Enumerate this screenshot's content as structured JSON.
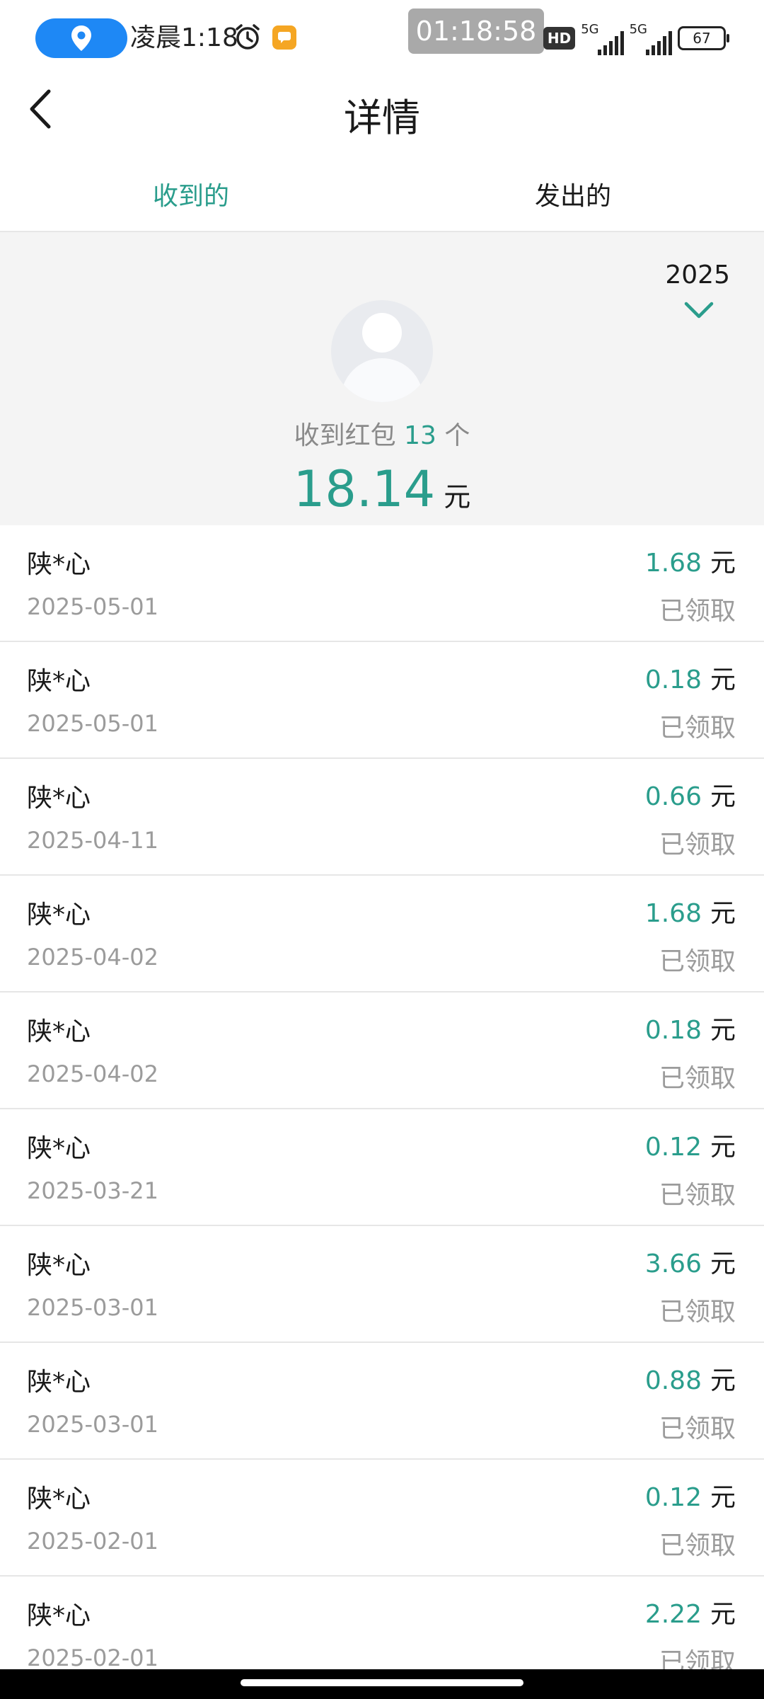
{
  "status_bar": {
    "time": "凌晨1:18",
    "clock_overlay": "01:18:58",
    "hd_badge": "HD",
    "network_1": "5G",
    "network_2": "5G",
    "battery": "67"
  },
  "header": {
    "title": "详情"
  },
  "tabs": [
    {
      "label": "收到的",
      "active": true
    },
    {
      "label": "发出的",
      "active": false
    }
  ],
  "summary": {
    "year": "2025",
    "count_prefix": "收到红包",
    "count": "13",
    "count_suffix": "个",
    "total": "18.14",
    "total_unit": "元"
  },
  "records": [
    {
      "name": "陕*心",
      "date": "2025-05-01",
      "amount": "1.68",
      "unit": "元",
      "status": "已领取"
    },
    {
      "name": "陕*心",
      "date": "2025-05-01",
      "amount": "0.18",
      "unit": "元",
      "status": "已领取"
    },
    {
      "name": "陕*心",
      "date": "2025-04-11",
      "amount": "0.66",
      "unit": "元",
      "status": "已领取"
    },
    {
      "name": "陕*心",
      "date": "2025-04-02",
      "amount": "1.68",
      "unit": "元",
      "status": "已领取"
    },
    {
      "name": "陕*心",
      "date": "2025-04-02",
      "amount": "0.18",
      "unit": "元",
      "status": "已领取"
    },
    {
      "name": "陕*心",
      "date": "2025-03-21",
      "amount": "0.12",
      "unit": "元",
      "status": "已领取"
    },
    {
      "name": "陕*心",
      "date": "2025-03-01",
      "amount": "3.66",
      "unit": "元",
      "status": "已领取"
    },
    {
      "name": "陕*心",
      "date": "2025-03-01",
      "amount": "0.88",
      "unit": "元",
      "status": "已领取"
    },
    {
      "name": "陕*心",
      "date": "2025-02-01",
      "amount": "0.12",
      "unit": "元",
      "status": "已领取"
    },
    {
      "name": "陕*心",
      "date": "2025-02-01",
      "amount": "2.22",
      "unit": "元",
      "status": "已领取"
    }
  ],
  "colors": {
    "accent": "#2a9d8c",
    "location_pill": "#1e88f5",
    "summary_bg": "#f4f4f4"
  },
  "icons": {
    "location": "location-pin-icon",
    "alarm": "alarm-clock-icon",
    "app": "notification-app-icon",
    "back": "chevron-left-icon",
    "year_toggle": "chevron-down-icon",
    "avatar": "default-avatar-icon"
  }
}
